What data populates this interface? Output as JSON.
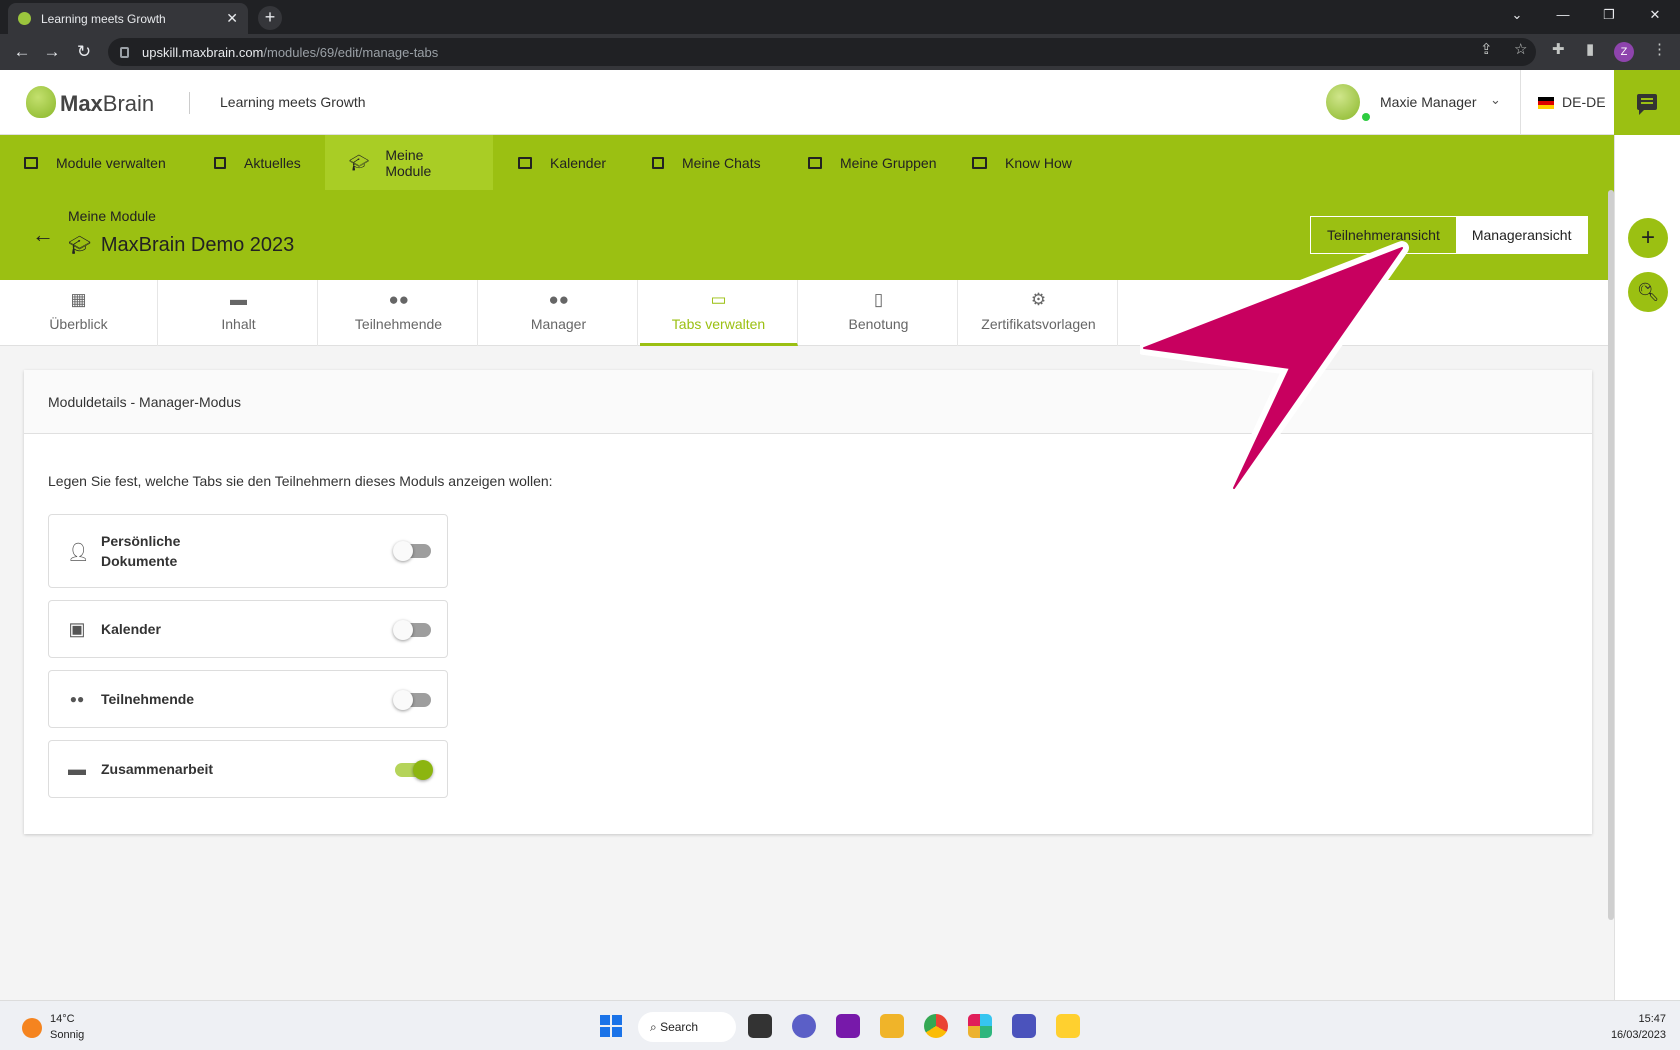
{
  "browser": {
    "tab_title": "Learning meets Growth",
    "tab_close": "✕",
    "new_tab": "+",
    "url_host": "upskill.maxbrain.com",
    "url_path": "/modules/69/edit/manage-tabs",
    "profile_initial": "Z"
  },
  "header": {
    "logo_max": "Max",
    "logo_brain": "Brain",
    "tagline": "Learning meets Growth",
    "user_name": "Maxie Manager",
    "language": "DE-DE"
  },
  "main_nav": {
    "items": [
      {
        "label": "Module verwalten"
      },
      {
        "label": "Aktuelles"
      },
      {
        "label": "Meine Module",
        "active": true
      },
      {
        "label": "Kalender"
      },
      {
        "label": "Meine Chats"
      },
      {
        "label": "Meine Gruppen"
      },
      {
        "label": "Know How"
      }
    ]
  },
  "module": {
    "breadcrumb": "Meine Module",
    "title": "MaxBrain Demo 2023",
    "view_participant": "Teilnehmeransicht",
    "view_manager": "Manageransicht"
  },
  "sub_tabs": [
    {
      "label": "Überblick",
      "icon": "dashboard-icon"
    },
    {
      "label": "Inhalt",
      "icon": "folder-icon"
    },
    {
      "label": "Teilnehmende",
      "icon": "people-icon"
    },
    {
      "label": "Manager",
      "icon": "manager-icon"
    },
    {
      "label": "Tabs verwalten",
      "icon": "tabs-icon",
      "active": true
    },
    {
      "label": "Benotung",
      "icon": "grade-icon"
    },
    {
      "label": "Zertifikatsvorlagen",
      "icon": "certificate-icon"
    }
  ],
  "card": {
    "title": "Moduldetails - Manager-Modus",
    "intro": "Legen Sie fest, welche Tabs sie den Teilnehmern dieses Moduls anzeigen wollen:",
    "toggles": [
      {
        "label_line1": "Persönliche",
        "label_line2": "Dokumente",
        "on": false,
        "icon": "personal-documents-icon"
      },
      {
        "label": "Kalender",
        "on": false,
        "icon": "calendar-icon"
      },
      {
        "label": "Teilnehmende",
        "on": false,
        "icon": "people-icon"
      },
      {
        "label": "Zusammenarbeit",
        "on": true,
        "icon": "shared-folder-icon"
      }
    ]
  },
  "taskbar": {
    "temperature": "14°C",
    "weather": "Sonnig",
    "search": "Search",
    "time": "15:47",
    "date": "16/03/2023"
  },
  "colors": {
    "brand_green": "#9bc012",
    "pointer_magenta": "#c8005f"
  }
}
